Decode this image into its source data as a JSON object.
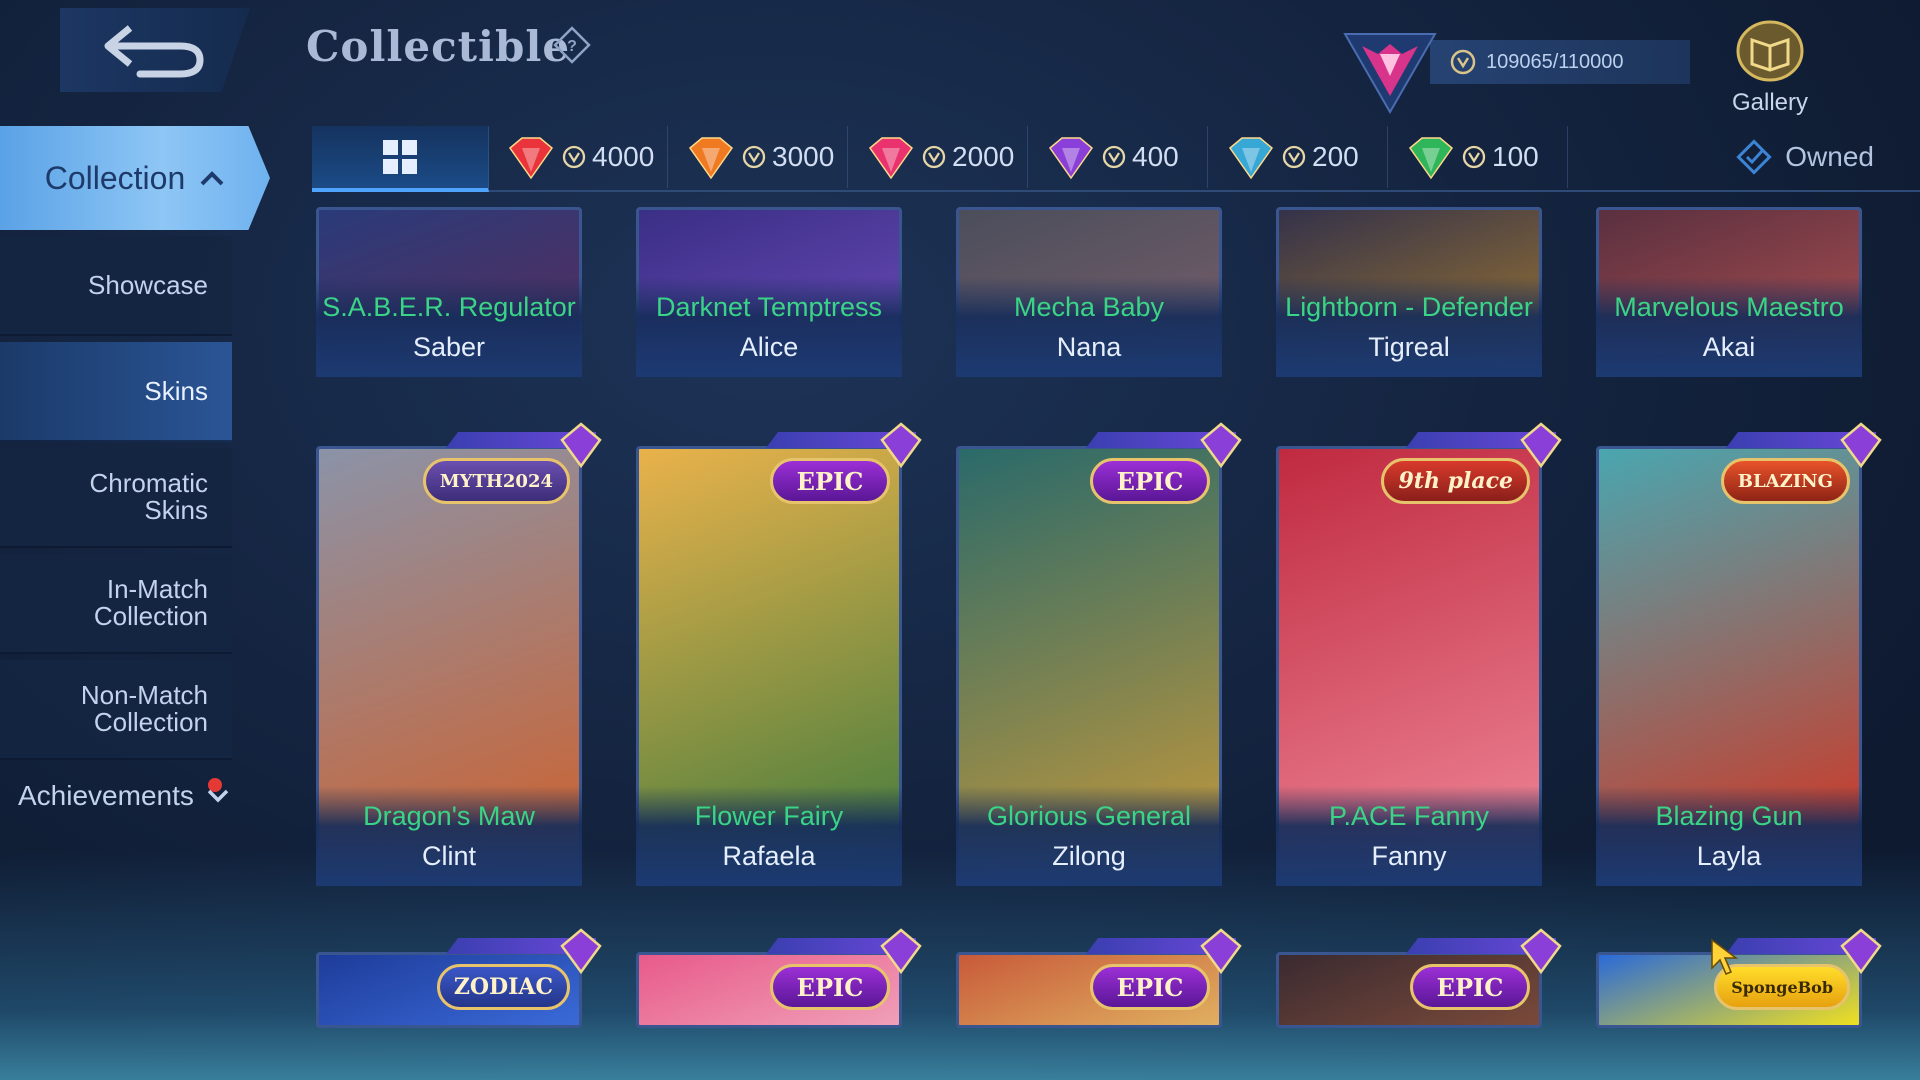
{
  "header": {
    "title": "Collectible",
    "points": "109065/110000",
    "gallery_label": "Gallery"
  },
  "sidebar": {
    "collection_label": "Collection",
    "items": [
      {
        "label": "Showcase"
      },
      {
        "label": "Skins"
      },
      {
        "label_line1": "Chromatic",
        "label_line2": "Skins"
      },
      {
        "label_line1": "In-Match",
        "label_line2": "Collection"
      },
      {
        "label_line1": "Non-Match",
        "label_line2": "Collection"
      }
    ],
    "achievements_label": "Achievements",
    "active_item": "Skins"
  },
  "tabs": {
    "prices": [
      {
        "value": "4000",
        "color": "#e8343a"
      },
      {
        "value": "3000",
        "color": "#f07a22"
      },
      {
        "value": "2000",
        "color": "#e9326e"
      },
      {
        "value": "400",
        "color": "#8a3fd8"
      },
      {
        "value": "200",
        "color": "#37a7d6"
      },
      {
        "value": "100",
        "color": "#2fb55a"
      }
    ],
    "owned_label": "Owned"
  },
  "cards_top": [
    {
      "skin": "S.A.B.E.R. Regulator",
      "hero": "Saber",
      "bg": [
        "#2a3b7a",
        "#5a2c5a"
      ]
    },
    {
      "skin": "Darknet Temptress",
      "hero": "Alice",
      "bg": [
        "#3a2f86",
        "#6c4bb8"
      ]
    },
    {
      "skin": "Mecha Baby",
      "hero": "Nana",
      "bg": [
        "#4b4e5c",
        "#7a5f6a"
      ]
    },
    {
      "skin": "Lightborn - Defender",
      "hero": "Tigreal",
      "bg": [
        "#34324a",
        "#a07830"
      ]
    },
    {
      "skin": "Marvelous Maestro",
      "hero": "Akai",
      "bg": [
        "#5a3040",
        "#b05050"
      ]
    }
  ],
  "cards_middle": [
    {
      "skin": "Dragon's Maw",
      "hero": "Clint",
      "badge": "MYTH2024",
      "badge_type": "myth",
      "bg": [
        "#8b93a8",
        "#d0602a"
      ]
    },
    {
      "skin": "Flower Fairy",
      "hero": "Rafaela",
      "badge": "EPIC",
      "badge_type": "epic",
      "bg": [
        "#e9b24b",
        "#3c7a3c"
      ]
    },
    {
      "skin": "Glorious General",
      "hero": "Zilong",
      "badge": "EPIC",
      "badge_type": "epic",
      "bg": [
        "#2a6a6a",
        "#c89a3a"
      ]
    },
    {
      "skin": "P.ACE Fanny",
      "hero": "Fanny",
      "badge": "9th place",
      "badge_type": "event",
      "bg": [
        "#c02a40",
        "#f08a9a"
      ]
    },
    {
      "skin": "Blazing Gun",
      "hero": "Layla",
      "badge": "BLAZING",
      "badge_type": "blazing",
      "bg": [
        "#4aa6b0",
        "#d8301c"
      ]
    }
  ],
  "cards_bottom": [
    {
      "badge": "ZODIAC",
      "badge_type": "zodiac",
      "bg": [
        "#1e3c9a",
        "#3a6ad8"
      ]
    },
    {
      "badge": "EPIC",
      "badge_type": "epic",
      "bg": [
        "#e85a8a",
        "#f0a0b8"
      ]
    },
    {
      "badge": "EPIC",
      "badge_type": "epic",
      "bg": [
        "#c85a3a",
        "#e0b060"
      ]
    },
    {
      "badge": "EPIC",
      "badge_type": "epic",
      "bg": [
        "#3a2a30",
        "#7a4a3a"
      ]
    },
    {
      "badge": "SpongeBob",
      "badge_type": "sponge",
      "bg": [
        "#2a6ad8",
        "#f0e020"
      ]
    }
  ]
}
